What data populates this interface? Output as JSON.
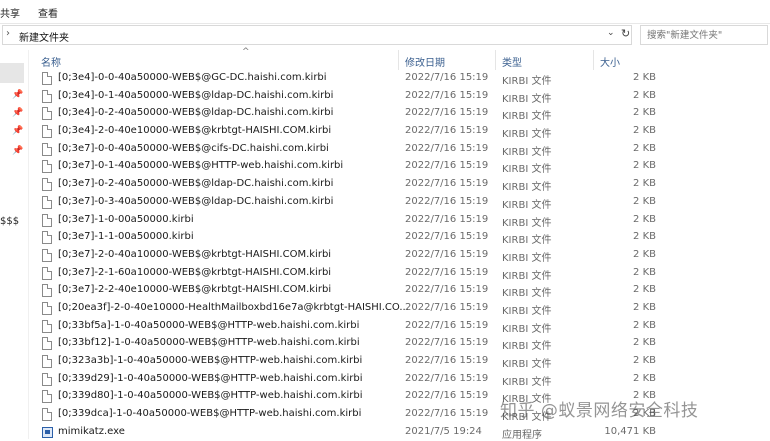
{
  "ribbon": {
    "tabs": [
      "共享",
      "查看"
    ]
  },
  "address": {
    "path": "新建文件夹"
  },
  "search": {
    "placeholder": "搜索\"新建文件夹\""
  },
  "nav": {
    "label": "$$$"
  },
  "columns": {
    "name": "名称",
    "date": "修改日期",
    "type": "类型",
    "size": "大小"
  },
  "files": [
    {
      "name": "[0;3e4]-0-0-40a50000-WEB$@GC-DC.haishi.com.kirbi",
      "date": "2022/7/16 15:19",
      "type": "KIRBI 文件",
      "size": "2 KB",
      "icon": "file-icon"
    },
    {
      "name": "[0;3e4]-0-1-40a50000-WEB$@ldap-DC.haishi.com.kirbi",
      "date": "2022/7/16 15:19",
      "type": "KIRBI 文件",
      "size": "2 KB",
      "icon": "file-icon"
    },
    {
      "name": "[0;3e4]-0-2-40a50000-WEB$@ldap-DC.haishi.com.kirbi",
      "date": "2022/7/16 15:19",
      "type": "KIRBI 文件",
      "size": "2 KB",
      "icon": "file-icon"
    },
    {
      "name": "[0;3e4]-2-0-40e10000-WEB$@krbtgt-HAISHI.COM.kirbi",
      "date": "2022/7/16 15:19",
      "type": "KIRBI 文件",
      "size": "2 KB",
      "icon": "file-icon"
    },
    {
      "name": "[0;3e7]-0-0-40a50000-WEB$@cifs-DC.haishi.com.kirbi",
      "date": "2022/7/16 15:19",
      "type": "KIRBI 文件",
      "size": "2 KB",
      "icon": "file-icon"
    },
    {
      "name": "[0;3e7]-0-1-40a50000-WEB$@HTTP-web.haishi.com.kirbi",
      "date": "2022/7/16 15:19",
      "type": "KIRBI 文件",
      "size": "2 KB",
      "icon": "file-icon"
    },
    {
      "name": "[0;3e7]-0-2-40a50000-WEB$@ldap-DC.haishi.com.kirbi",
      "date": "2022/7/16 15:19",
      "type": "KIRBI 文件",
      "size": "2 KB",
      "icon": "file-icon"
    },
    {
      "name": "[0;3e7]-0-3-40a50000-WEB$@ldap-DC.haishi.com.kirbi",
      "date": "2022/7/16 15:19",
      "type": "KIRBI 文件",
      "size": "2 KB",
      "icon": "file-icon"
    },
    {
      "name": "[0;3e7]-1-0-00a50000.kirbi",
      "date": "2022/7/16 15:19",
      "type": "KIRBI 文件",
      "size": "2 KB",
      "icon": "file-icon"
    },
    {
      "name": "[0;3e7]-1-1-00a50000.kirbi",
      "date": "2022/7/16 15:19",
      "type": "KIRBI 文件",
      "size": "2 KB",
      "icon": "file-icon"
    },
    {
      "name": "[0;3e7]-2-0-40a10000-WEB$@krbtgt-HAISHI.COM.kirbi",
      "date": "2022/7/16 15:19",
      "type": "KIRBI 文件",
      "size": "2 KB",
      "icon": "file-icon"
    },
    {
      "name": "[0;3e7]-2-1-60a10000-WEB$@krbtgt-HAISHI.COM.kirbi",
      "date": "2022/7/16 15:19",
      "type": "KIRBI 文件",
      "size": "2 KB",
      "icon": "file-icon"
    },
    {
      "name": "[0;3e7]-2-2-40e10000-WEB$@krbtgt-HAISHI.COM.kirbi",
      "date": "2022/7/16 15:19",
      "type": "KIRBI 文件",
      "size": "2 KB",
      "icon": "file-icon"
    },
    {
      "name": "[0;20ea3f]-2-0-40e10000-HealthMailboxbd16e7a@krbtgt-HAISHI.CO...",
      "date": "2022/7/16 15:19",
      "type": "KIRBI 文件",
      "size": "2 KB",
      "icon": "file-icon"
    },
    {
      "name": "[0;33bf5a]-1-0-40a50000-WEB$@HTTP-web.haishi.com.kirbi",
      "date": "2022/7/16 15:19",
      "type": "KIRBI 文件",
      "size": "2 KB",
      "icon": "file-icon"
    },
    {
      "name": "[0;33bf12]-1-0-40a50000-WEB$@HTTP-web.haishi.com.kirbi",
      "date": "2022/7/16 15:19",
      "type": "KIRBI 文件",
      "size": "2 KB",
      "icon": "file-icon"
    },
    {
      "name": "[0;323a3b]-1-0-40a50000-WEB$@HTTP-web.haishi.com.kirbi",
      "date": "2022/7/16 15:19",
      "type": "KIRBI 文件",
      "size": "2 KB",
      "icon": "file-icon"
    },
    {
      "name": "[0;339d29]-1-0-40a50000-WEB$@HTTP-web.haishi.com.kirbi",
      "date": "2022/7/16 15:19",
      "type": "KIRBI 文件",
      "size": "2 KB",
      "icon": "file-icon"
    },
    {
      "name": "[0;339d80]-1-0-40a50000-WEB$@HTTP-web.haishi.com.kirbi",
      "date": "2022/7/16 15:19",
      "type": "KIRBI 文件",
      "size": "2 KB",
      "icon": "file-icon"
    },
    {
      "name": "[0;339dca]-1-0-40a50000-WEB$@HTTP-web.haishi.com.kirbi",
      "date": "2022/7/16 15:19",
      "type": "KIRBI 文件",
      "size": "2 KB",
      "icon": "file-icon"
    },
    {
      "name": "mimikatz.exe",
      "date": "2021/7/5 19:24",
      "type": "应用程序",
      "size": "10,471 KB",
      "icon": "exe-icon"
    }
  ],
  "watermark": "知乎 @蚁景网络安全科技"
}
